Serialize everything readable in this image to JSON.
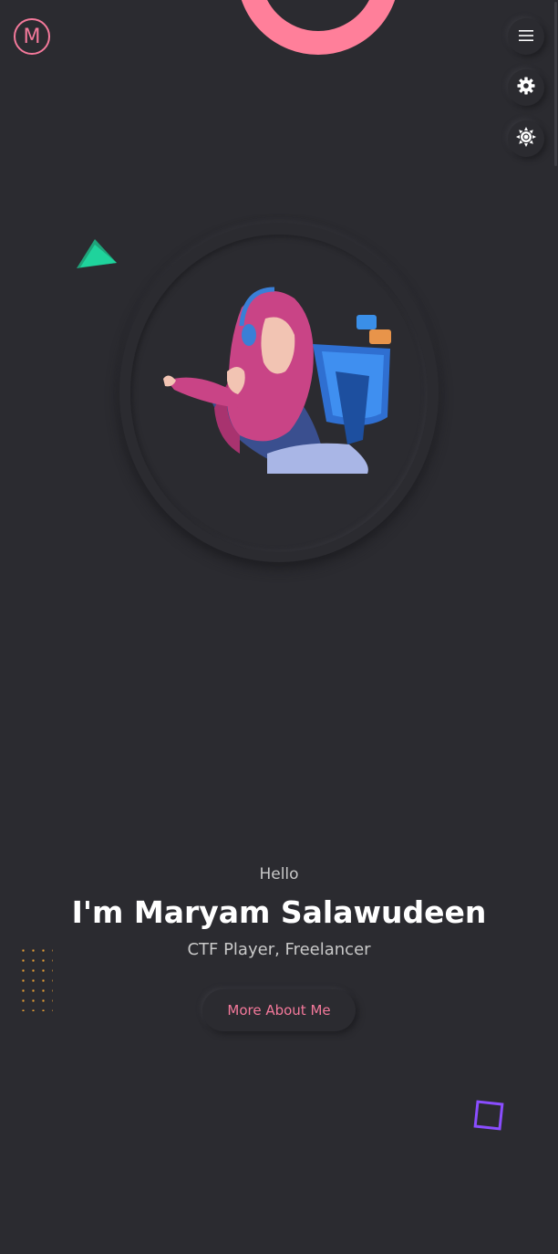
{
  "logo": {
    "letter": "M"
  },
  "controls": {
    "menu_icon": "hamburger-icon",
    "settings_icon": "gear-icon",
    "theme_icon": "sun-icon"
  },
  "hero": {
    "greeting": "Hello",
    "name": "I'm Maryam Salawudeen",
    "roles": "CTF Player, Freelancer",
    "cta_label": "More About Me"
  },
  "colors": {
    "background": "#2b2b30",
    "accent_pink": "#f4799b",
    "green": "#1fd39c",
    "purple": "#8a4dff",
    "orange": "#e8a036"
  }
}
